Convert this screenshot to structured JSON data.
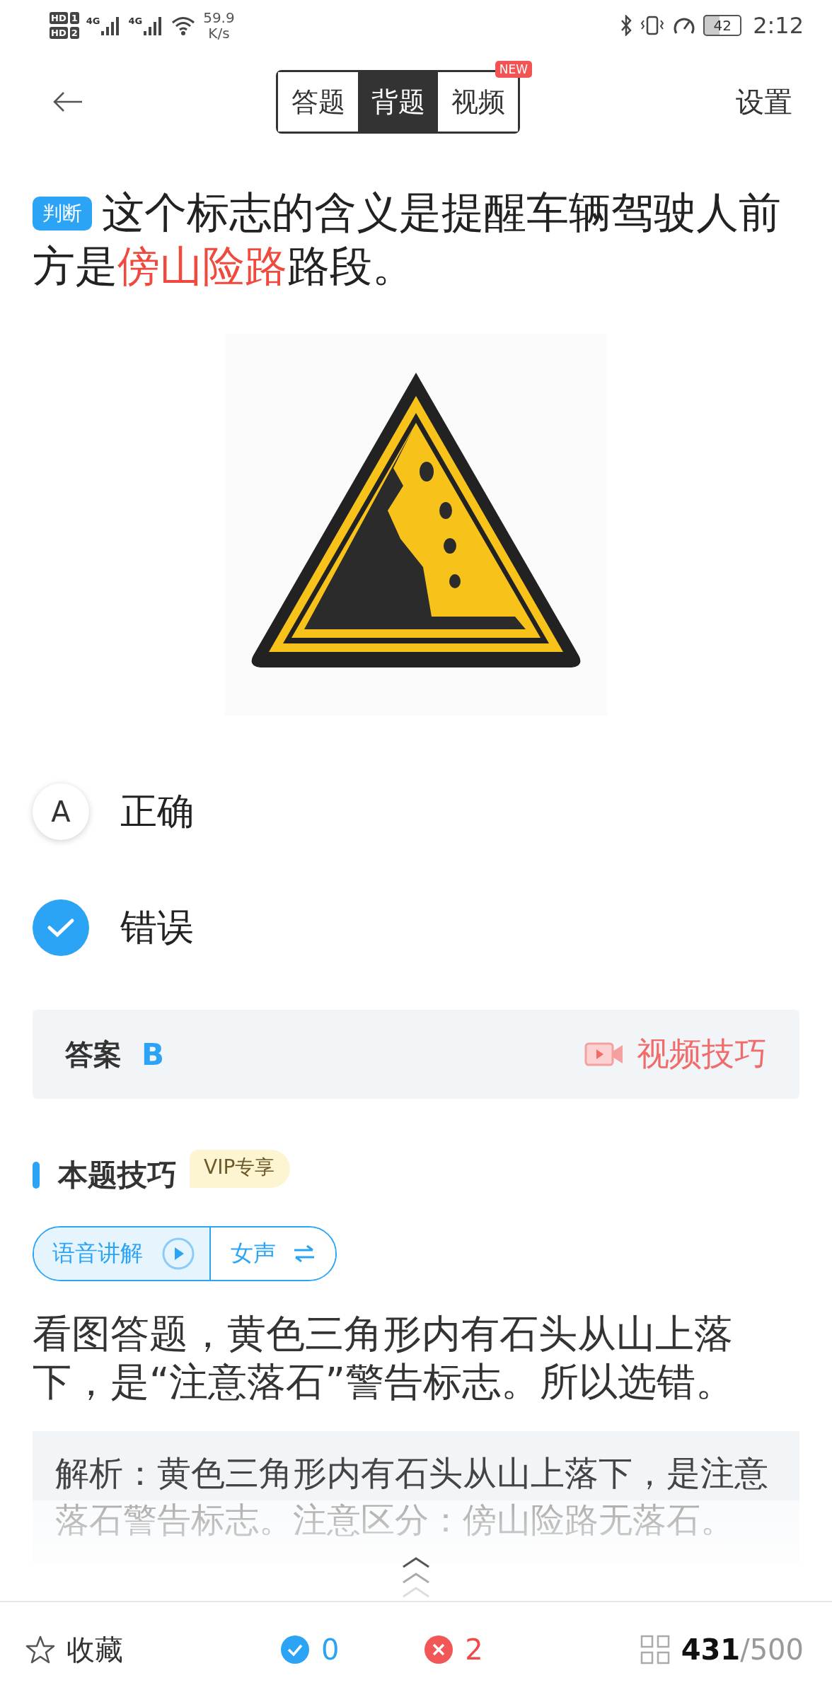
{
  "status_bar": {
    "sims": [
      {
        "label": "HD",
        "slot": "1"
      },
      {
        "label": "HD",
        "slot": "2"
      }
    ],
    "networks": [
      "4G",
      "4G"
    ],
    "speed": "59.9",
    "speed_unit": "K/s",
    "battery": "42",
    "time": "2:12"
  },
  "header": {
    "tabs": [
      {
        "label": "答题",
        "selected": false
      },
      {
        "label": "背题",
        "selected": true
      },
      {
        "label": "视频",
        "selected": false,
        "badge": "NEW"
      }
    ],
    "settings": "设置"
  },
  "question": {
    "tag": "判断",
    "segments": [
      {
        "text": "这个标志的含义是提醒车辆驾驶人前方是",
        "highlight": false
      },
      {
        "text": "傍山险路",
        "highlight": true
      },
      {
        "text": "路段。",
        "highlight": false
      }
    ]
  },
  "options": [
    {
      "letter": "A",
      "text": "正确",
      "selected": false
    },
    {
      "text": "错误",
      "selected": true
    }
  ],
  "answer": {
    "label": "答案",
    "value": "B",
    "video_link": "视频技巧"
  },
  "tip": {
    "title": "本题技巧",
    "vip": "VIP专享",
    "audio": "语音讲解",
    "voice": "女声",
    "text": "看图答题，黄色三角形内有石头从山上落下，是“注意落石”警告标志。所以选错。"
  },
  "analysis": {
    "text": "解析：黄色三角形内有石头从山上落下，是注意落石警告标志。注意区分：傍山险路无落石。"
  },
  "bottom_bar": {
    "favorite": "收藏",
    "correct": "0",
    "wrong": "2",
    "current": "431",
    "total": "/500"
  }
}
